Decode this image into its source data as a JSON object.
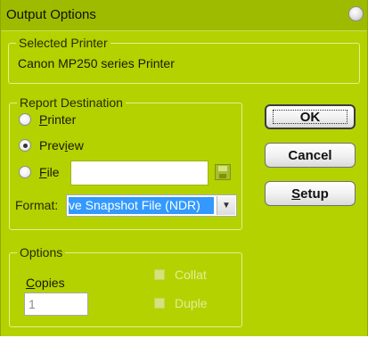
{
  "window": {
    "title": "Output Options",
    "title_icon": "circle-orb-icon"
  },
  "selected_printer": {
    "legend": "Selected Printer",
    "name": "Canon MP250 series Printer"
  },
  "report_destination": {
    "legend": "Report Destination",
    "options": [
      {
        "label": "Printer",
        "accel_index": 0,
        "checked": false
      },
      {
        "label": "Preview",
        "accel_index": 4,
        "checked": true
      },
      {
        "label": "File",
        "accel_index": 0,
        "checked": false
      }
    ],
    "file_path_value": "",
    "file_browse_icon": "floppy-disk-icon",
    "format_label": "Format:",
    "format_value": "ve Snapshot File (NDR)",
    "format_dropdown_icon": "triangle-down-icon"
  },
  "buttons": {
    "ok": "OK",
    "cancel": "Cancel",
    "setup": "Setup"
  },
  "options": {
    "legend": "Options",
    "copies_label": "Copies",
    "copies_value": "1",
    "collate_label": "Collate",
    "duplex_label": "Duplex"
  },
  "colors": {
    "dialog_bg": "#b4d200",
    "titlebar_bg": "#9fbb00",
    "selection": "#3399ff",
    "disabled_text": "#e2ee9a"
  }
}
